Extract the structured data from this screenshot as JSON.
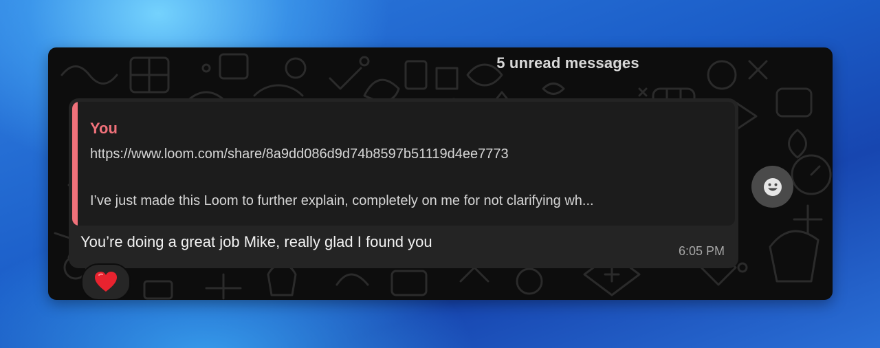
{
  "chat": {
    "unread_banner": "5 unread messages",
    "message": {
      "quote": {
        "author": "You",
        "link": "https://www.loom.com/share/8a9dd086d9d74b8597b51119d4ee7773",
        "text": "I’ve just made this Loom to further explain, completely on me for not clarifying wh..."
      },
      "text": "You’re doing a great job Mike, really glad I found you",
      "time": "6:05 PM",
      "reaction": "heart"
    },
    "react_button_icon": "smiley-icon"
  },
  "colors": {
    "quote_accent": "#f0717a",
    "window_bg": "#0d0d0d",
    "bubble_bg": "#242424"
  }
}
